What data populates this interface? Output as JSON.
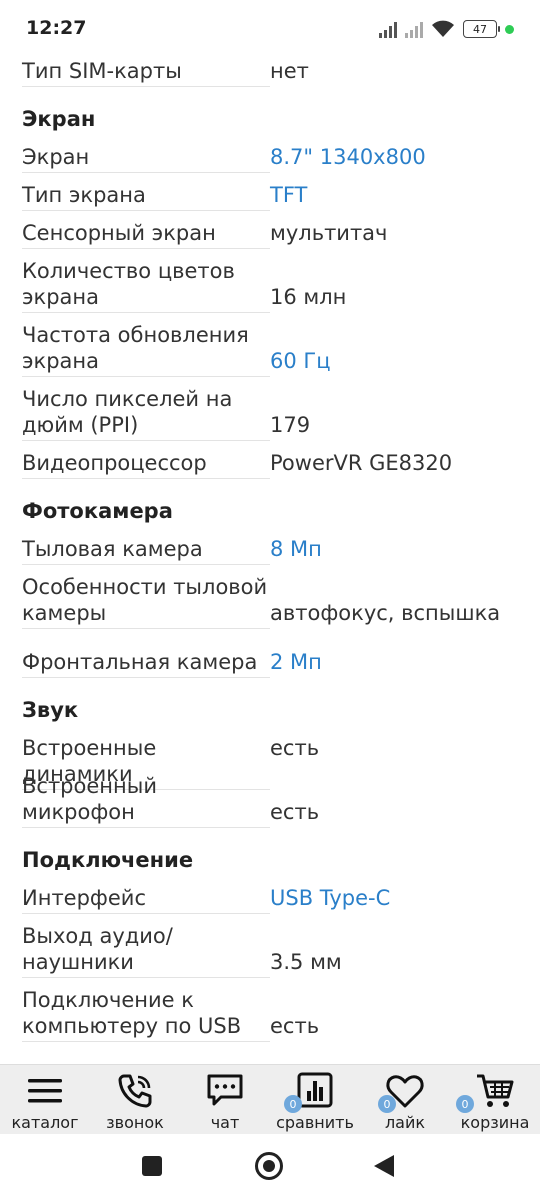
{
  "status": {
    "time": "12:27",
    "battery": "47"
  },
  "specs": {
    "sim_type": {
      "label": "Тип SIM-карты",
      "value": "нет"
    },
    "screen_section": "Экран",
    "screen": {
      "label": "Экран",
      "value": "8.7\" 1340x800"
    },
    "screen_type": {
      "label": "Тип экрана",
      "value": "TFT"
    },
    "touch": {
      "label": "Сенсорный экран",
      "value": "мультитач"
    },
    "colors": {
      "label_l1": "Количество цветов",
      "label_l2": "экрана",
      "value": "16 млн"
    },
    "refresh": {
      "label_l1": "Частота обновления",
      "label_l2": "экрана",
      "value": "60 Гц"
    },
    "ppi": {
      "label_l1": "Число пикселей на",
      "label_l2": "дюйм (PPI)",
      "value": "179"
    },
    "gpu": {
      "label": "Видеопроцессор",
      "value": "PowerVR GE8320"
    },
    "camera_section": "Фотокамера",
    "rear_camera": {
      "label": "Тыловая камера",
      "value": "8 Мп"
    },
    "rear_features": {
      "label_l1": "Особенности тыловой",
      "label_l2": "камеры",
      "value": "автофокус, вспышка"
    },
    "front_camera": {
      "label": "Фронтальная камера",
      "value": "2 Мп"
    },
    "sound_section": "Звук",
    "speakers": {
      "label": "Встроенные динамики",
      "value": "есть"
    },
    "mic": {
      "label_l1": "Встроенный",
      "label_l2": "микрофон",
      "value": "есть"
    },
    "connect_section": "Подключение",
    "interface": {
      "label": "Интерфейс",
      "value": "USB Type-C"
    },
    "audio_out": {
      "label_l1": "Выход аудио/",
      "label_l2": "наушники",
      "value": "3.5 мм"
    },
    "usb_pc": {
      "label_l1": "Подключение к",
      "label_l2": "компьютеру по USB",
      "value": "есть"
    }
  },
  "bottom_nav": {
    "catalog": "каталог",
    "call": "звонок",
    "chat": "чат",
    "compare": "сравнить",
    "compare_count": "0",
    "like": "лайк",
    "like_count": "0",
    "cart": "корзина",
    "cart_count": "0"
  },
  "icons": [
    "menu-icon",
    "phone-icon",
    "chat-icon",
    "chart-icon",
    "heart-icon",
    "cart-icon"
  ],
  "colors": {
    "link": "#2a7fc9",
    "badge": "#6fa8dc",
    "nav_bg": "#eeeeee"
  }
}
